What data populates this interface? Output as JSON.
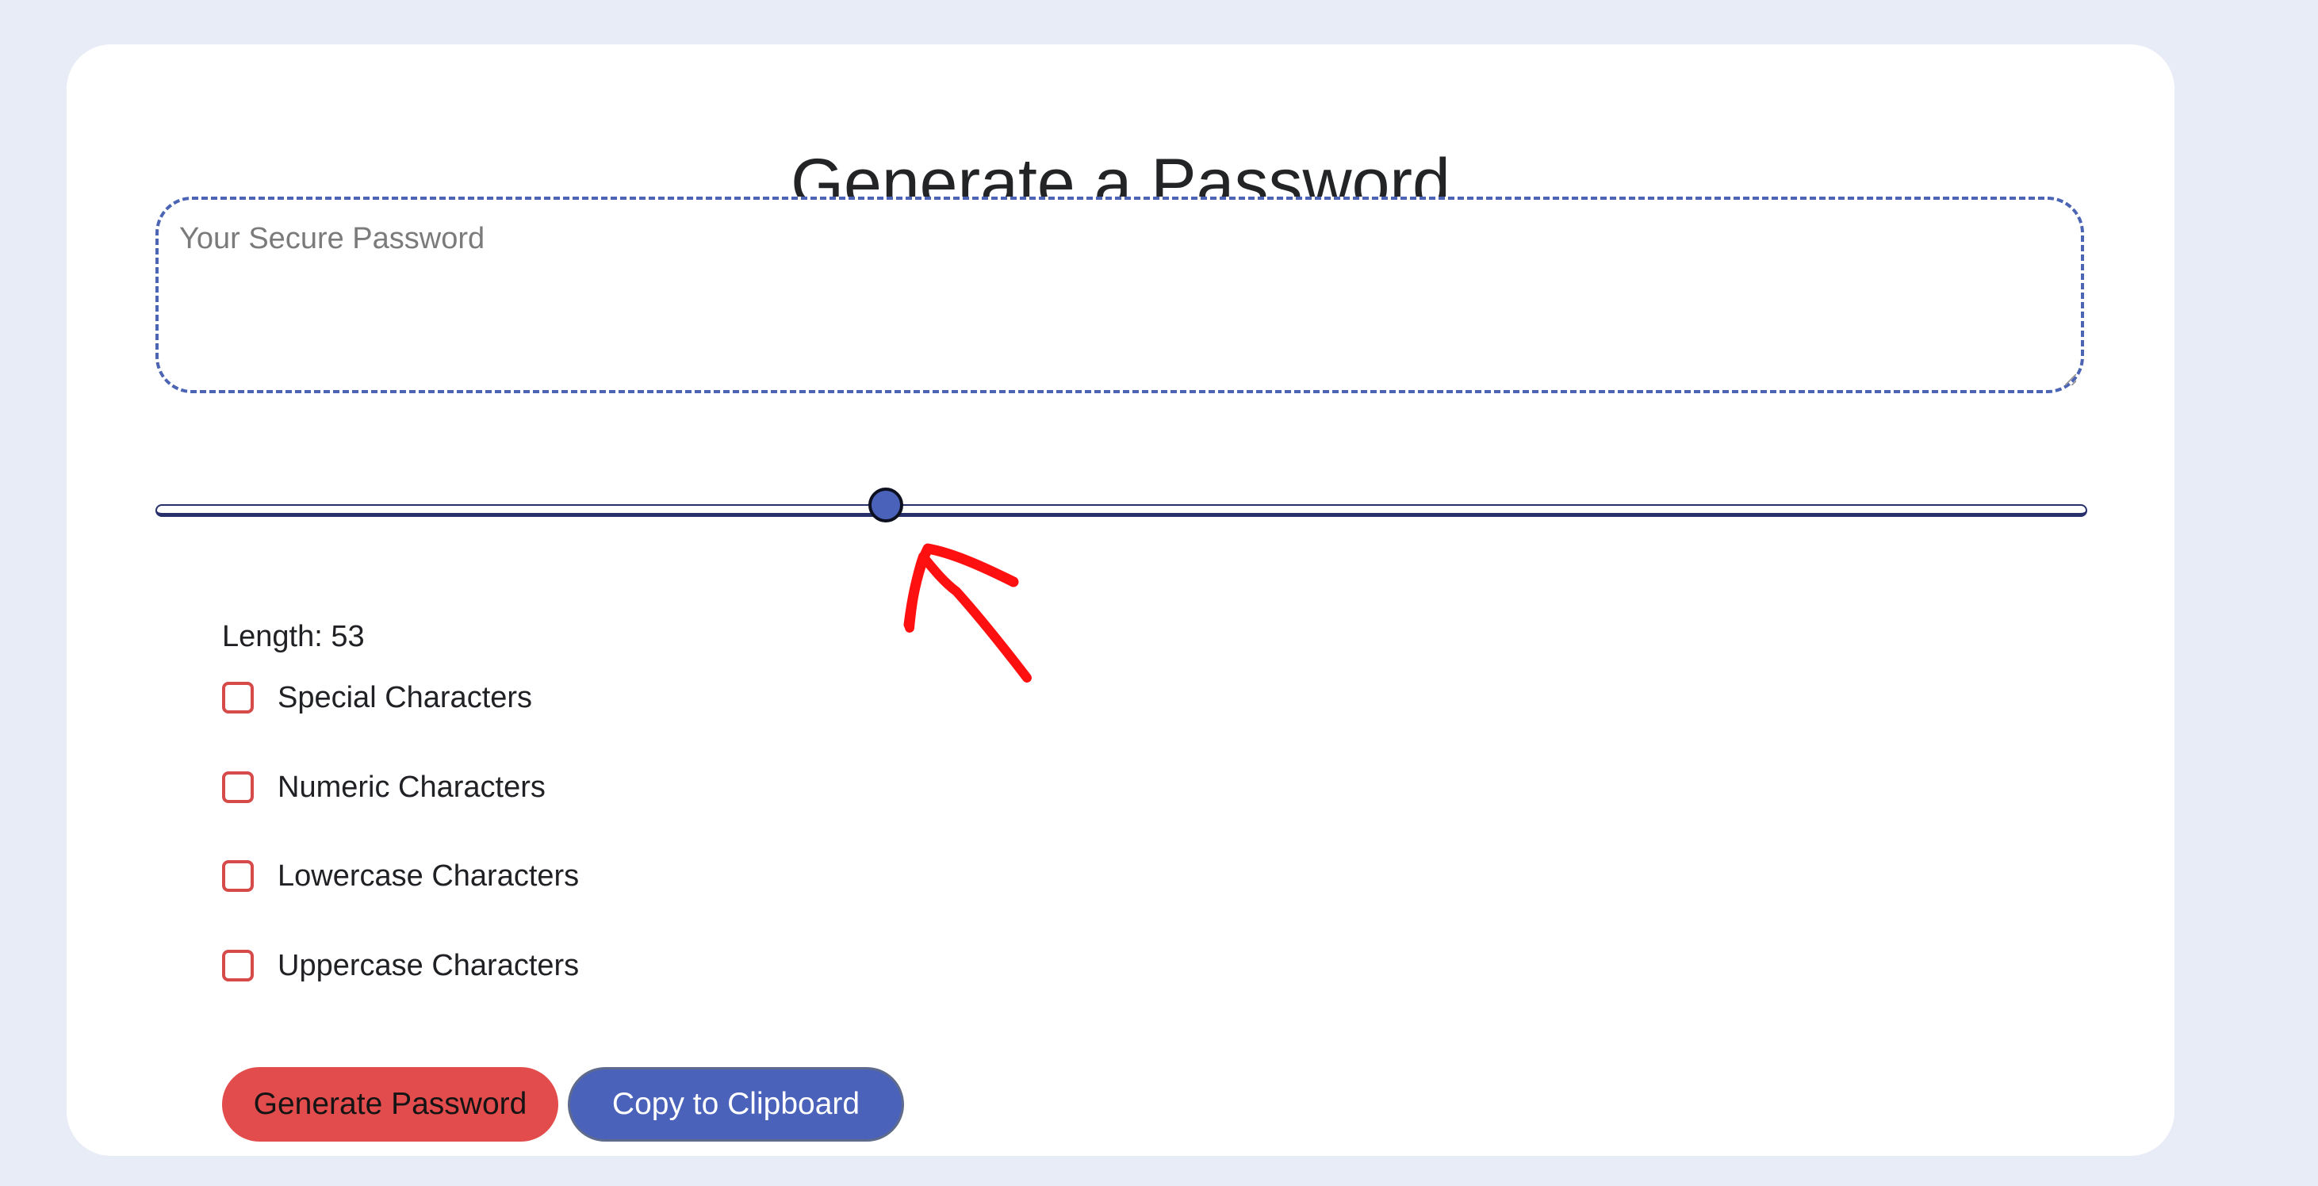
{
  "page": {
    "title": "Generate a Password"
  },
  "password_field": {
    "placeholder": "Your Secure Password",
    "value": ""
  },
  "length_slider": {
    "value": 53,
    "min": 8,
    "max": 128,
    "fill_fraction": 0.378
  },
  "length_label": "Length: 53",
  "options": [
    {
      "label": "Special Characters",
      "checked": false
    },
    {
      "label": "Numeric Characters",
      "checked": false
    },
    {
      "label": "Lowercase Characters",
      "checked": false
    },
    {
      "label": "Uppercase Characters",
      "checked": false
    }
  ],
  "buttons": {
    "generate": "Generate Password",
    "copy": "Copy to Clipboard"
  },
  "colors": {
    "page_bg": "#e8ecf6",
    "card_bg": "#ffffff",
    "accent_blue": "#4b62bb",
    "accent_red": "#e34c4c",
    "annotation_red": "#ff0000"
  },
  "icons": {
    "annotation": "red-arrow-annotation"
  }
}
